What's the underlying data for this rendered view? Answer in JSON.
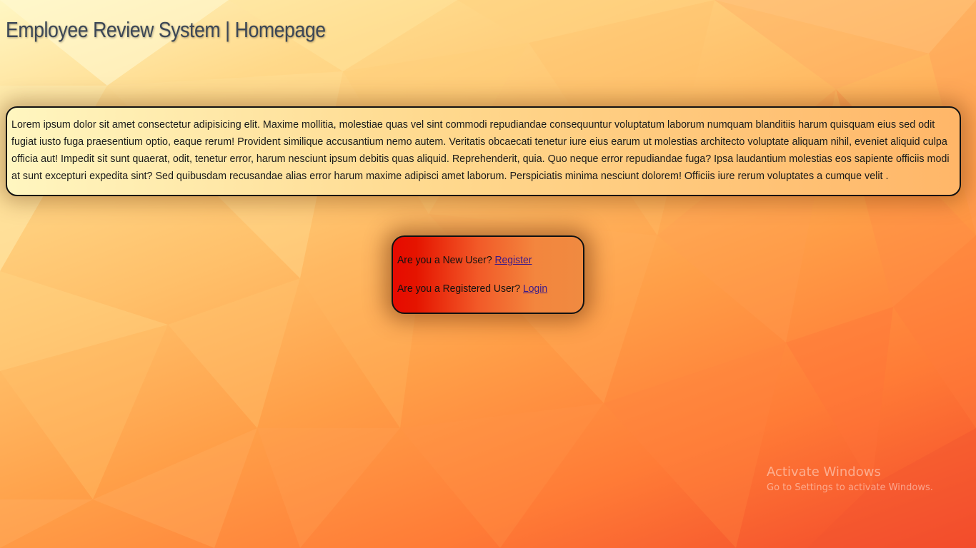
{
  "header": {
    "title": "Employee Review System | Homepage"
  },
  "intro": {
    "text": "Lorem ipsum dolor sit amet consectetur adipisicing elit. Maxime mollitia, molestiae quas vel sint commodi repudiandae consequuntur voluptatum laborum numquam blanditiis harum quisquam eius sed odit fugiat iusto fuga praesentium optio, eaque rerum! Provident similique accusantium nemo autem. Veritatis obcaecati tenetur iure eius earum ut molestias architecto voluptate aliquam nihil, eveniet aliquid culpa officia aut! Impedit sit sunt quaerat, odit, tenetur error, harum nesciunt ipsum debitis quas aliquid. Reprehenderit, quia. Quo neque error repudiandae fuga? Ipsa laudantium molestias eos sapiente officiis modi at sunt excepturi expedita sint? Sed quibusdam recusandae alias error harum maxime adipisci amet laborum. Perspiciatis minima nesciunt dolorem! Officiis iure rerum voluptates a cumque velit ."
  },
  "auth": {
    "new_user_prompt": "Are you a New User?",
    "register_link": "Register",
    "registered_user_prompt": "Are you a Registered User?",
    "login_link": "Login"
  },
  "os_watermark": {
    "title": "Activate Windows",
    "subtitle": "Go to Settings to activate Windows."
  },
  "colors": {
    "title_text": "#3c4756",
    "link": "#3a1a8a",
    "auth_card_left": "#e60a00",
    "auth_card_right": "#f08a40",
    "intro_card_left": "#fff6c0",
    "intro_card_right": "#ffb668"
  }
}
